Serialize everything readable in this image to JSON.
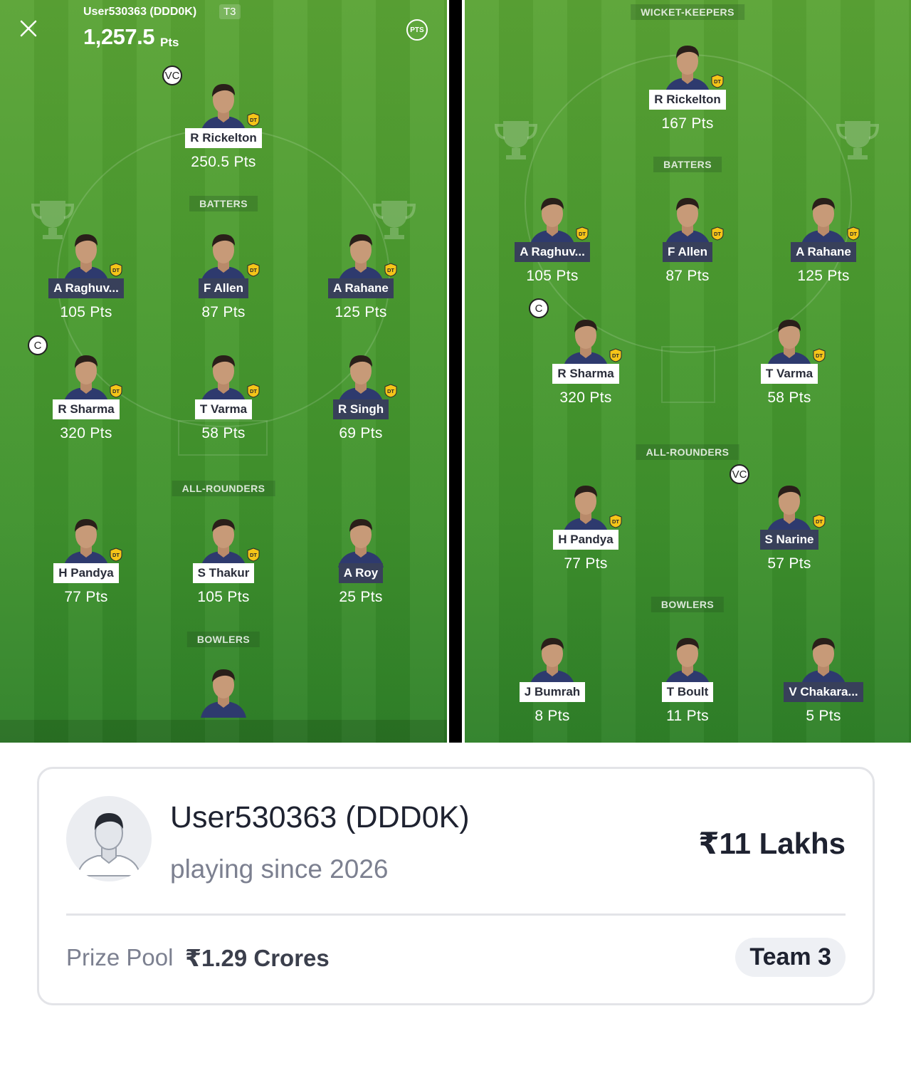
{
  "header": {
    "user": "User530363 (DDD0K)",
    "team_tag": "T3",
    "points": "1,257.5",
    "points_unit": "Pts",
    "pts_button": "PTS"
  },
  "left_panel": {
    "sections": {
      "batters": "BATTERS",
      "allrounders": "ALL-ROUNDERS",
      "bowlers": "BOWLERS"
    },
    "players": [
      {
        "name": "R Rickelton",
        "points": "250.5 Pts",
        "style": "light",
        "badge": "VC"
      },
      {
        "name": "A Raghuv...",
        "points": "105 Pts",
        "style": "dark"
      },
      {
        "name": "F Allen",
        "points": "87 Pts",
        "style": "dark"
      },
      {
        "name": "A Rahane",
        "points": "125 Pts",
        "style": "dark"
      },
      {
        "name": "R Sharma",
        "points": "320 Pts",
        "style": "light",
        "badge": "C"
      },
      {
        "name": "T Varma",
        "points": "58 Pts",
        "style": "light"
      },
      {
        "name": "R Singh",
        "points": "69 Pts",
        "style": "dark"
      },
      {
        "name": "H Pandya",
        "points": "77 Pts",
        "style": "light"
      },
      {
        "name": "S Thakur",
        "points": "105 Pts",
        "style": "light"
      },
      {
        "name": "A Roy",
        "points": "25 Pts",
        "style": "dark"
      }
    ]
  },
  "right_panel": {
    "sections": {
      "wicketkeepers": "WICKET-KEEPERS",
      "batters": "BATTERS",
      "allrounders": "ALL-ROUNDERS",
      "bowlers": "BOWLERS"
    },
    "players": [
      {
        "name": "R Rickelton",
        "points": "167 Pts",
        "style": "light"
      },
      {
        "name": "A Raghuv...",
        "points": "105 Pts",
        "style": "dark"
      },
      {
        "name": "F Allen",
        "points": "87 Pts",
        "style": "dark"
      },
      {
        "name": "A Rahane",
        "points": "125 Pts",
        "style": "dark"
      },
      {
        "name": "R Sharma",
        "points": "320 Pts",
        "style": "light",
        "badge": "C"
      },
      {
        "name": "T Varma",
        "points": "58 Pts",
        "style": "light"
      },
      {
        "name": "H Pandya",
        "points": "77 Pts",
        "style": "light"
      },
      {
        "name": "S Narine",
        "points": "57 Pts",
        "style": "dark",
        "badge": "VC"
      },
      {
        "name": "J Bumrah",
        "points": "8 Pts",
        "style": "light"
      },
      {
        "name": "T Boult",
        "points": "11 Pts",
        "style": "light"
      },
      {
        "name": "V Chakara...",
        "points": "5 Pts",
        "style": "dark"
      }
    ]
  },
  "dt_badge": "DT",
  "card": {
    "user": "User530363 (DDD0K)",
    "since": "playing since 2026",
    "prize": "₹11 Lakhs",
    "pool_label": "Prize Pool",
    "pool_value": "₹1.29 Crores",
    "team": "Team 3"
  },
  "colors": {
    "field_green": "#4c9c30",
    "name_dark_bg": "#38405a",
    "dt_badge": "#f5c518"
  }
}
